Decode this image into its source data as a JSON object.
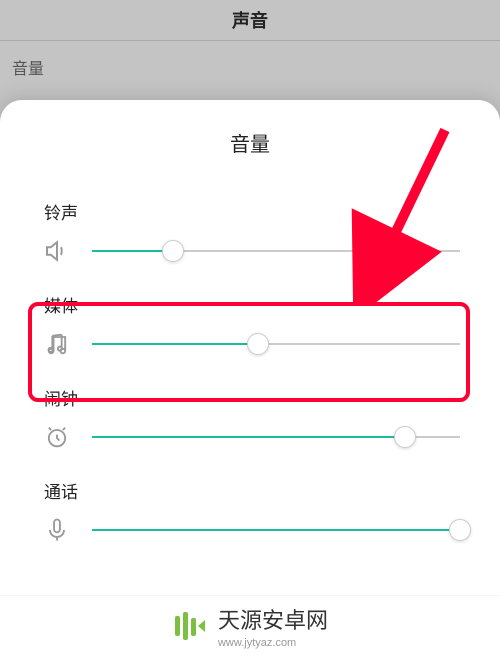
{
  "background": {
    "header": "声音",
    "section": "音量"
  },
  "modal": {
    "title": "音量",
    "rows": [
      {
        "key": "ringtone",
        "label": "铃声",
        "value": 22
      },
      {
        "key": "media",
        "label": "媒体",
        "value": 45
      },
      {
        "key": "alarm",
        "label": "闹钟",
        "value": 85
      },
      {
        "key": "call",
        "label": "通话",
        "value": 100
      }
    ]
  },
  "watermark": {
    "title": "天源安卓网",
    "url": "www.jytyaz.com"
  }
}
